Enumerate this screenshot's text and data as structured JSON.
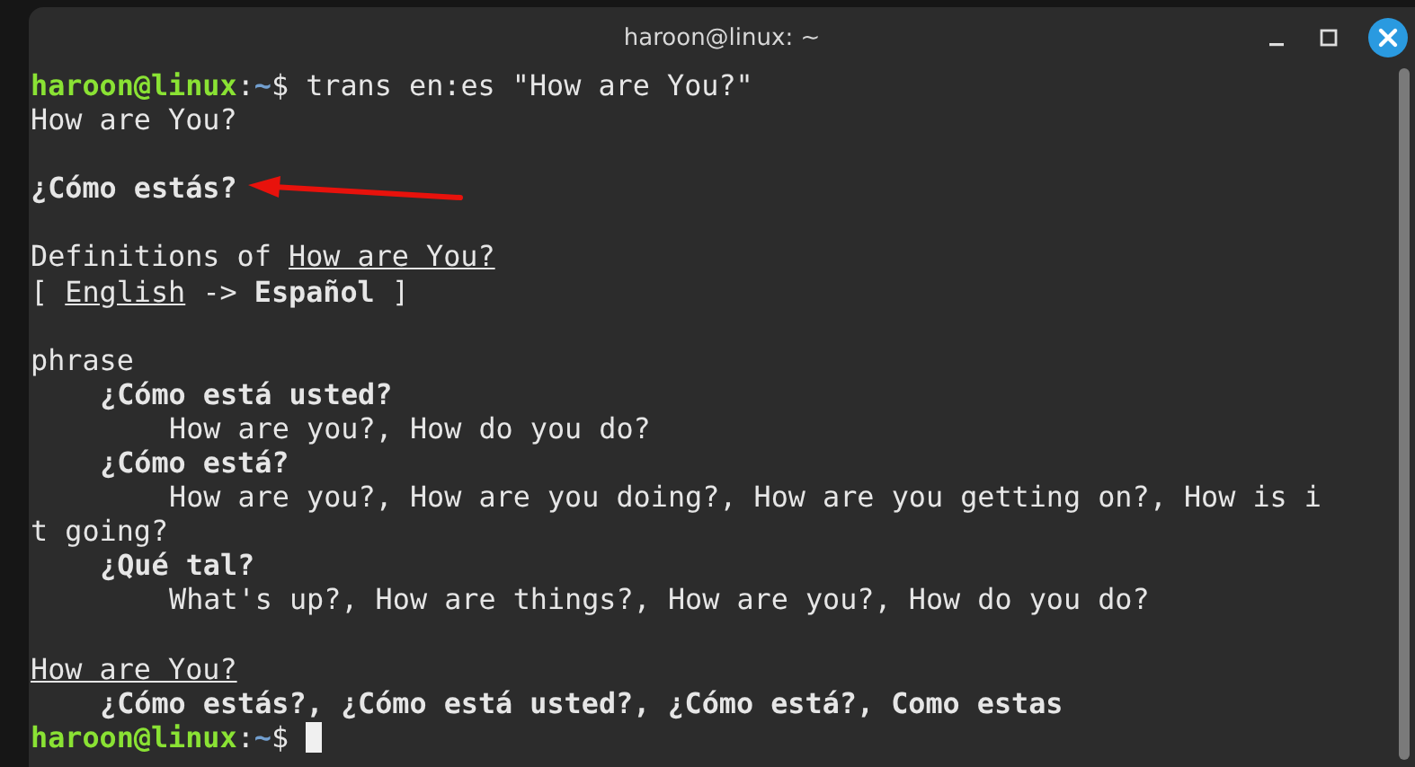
{
  "window": {
    "title": "haroon@linux: ~"
  },
  "lines": [
    {
      "kind": "prompt",
      "user": "haroon@linux",
      "separator": ":",
      "path": "~",
      "command": "$ trans en:es \"How are You?\"",
      "cursor": false
    },
    {
      "kind": "output",
      "segments": [
        {
          "kind": "plain",
          "text": "How are You?"
        }
      ]
    },
    {
      "kind": "blank"
    },
    {
      "kind": "output",
      "arrow": true,
      "segments": [
        {
          "kind": "bold",
          "text": "¿Cómo estás?"
        }
      ]
    },
    {
      "kind": "blank"
    },
    {
      "kind": "output",
      "segments": [
        {
          "kind": "plain",
          "text": "Definitions of "
        },
        {
          "kind": "link",
          "text": "How are You?"
        }
      ]
    },
    {
      "kind": "output",
      "segments": [
        {
          "kind": "plain",
          "text": "[ "
        },
        {
          "kind": "link",
          "text": "English"
        },
        {
          "kind": "plain",
          "text": " -> "
        },
        {
          "kind": "bold",
          "text": "Español"
        },
        {
          "kind": "plain",
          "text": " ]"
        }
      ]
    },
    {
      "kind": "blank"
    },
    {
      "kind": "output",
      "segments": [
        {
          "kind": "plain",
          "text": "phrase"
        }
      ]
    },
    {
      "kind": "term",
      "segments": [
        {
          "kind": "bold",
          "text": "¿Cómo está usted?"
        }
      ]
    },
    {
      "kind": "gloss",
      "segments": [
        {
          "kind": "plain",
          "text": "How are you?, How do you do?"
        }
      ]
    },
    {
      "kind": "term",
      "segments": [
        {
          "kind": "bold",
          "text": "¿Cómo está?"
        }
      ]
    },
    {
      "kind": "gloss",
      "segments": [
        {
          "kind": "plain",
          "text": "How are you?, How are you doing?, How are you getting on?, How is i"
        }
      ]
    },
    {
      "kind": "output",
      "segments": [
        {
          "kind": "plain",
          "text": "t going?"
        }
      ]
    },
    {
      "kind": "term",
      "segments": [
        {
          "kind": "bold",
          "text": "¿Qué tal?"
        }
      ]
    },
    {
      "kind": "gloss",
      "segments": [
        {
          "kind": "plain",
          "text": "What's up?, How are things?, How are you?, How do you do?"
        }
      ]
    },
    {
      "kind": "blank"
    },
    {
      "kind": "output",
      "segments": [
        {
          "kind": "link",
          "text": "How are You?"
        }
      ]
    },
    {
      "kind": "term",
      "segments": [
        {
          "kind": "bold",
          "text": "¿Cómo estás?, ¿Cómo está usted?, ¿Cómo está?, Como estas"
        }
      ]
    },
    {
      "kind": "prompt",
      "user": "haroon@linux",
      "separator": ":",
      "path": "~",
      "command": "$ ",
      "cursor": true
    }
  ]
}
